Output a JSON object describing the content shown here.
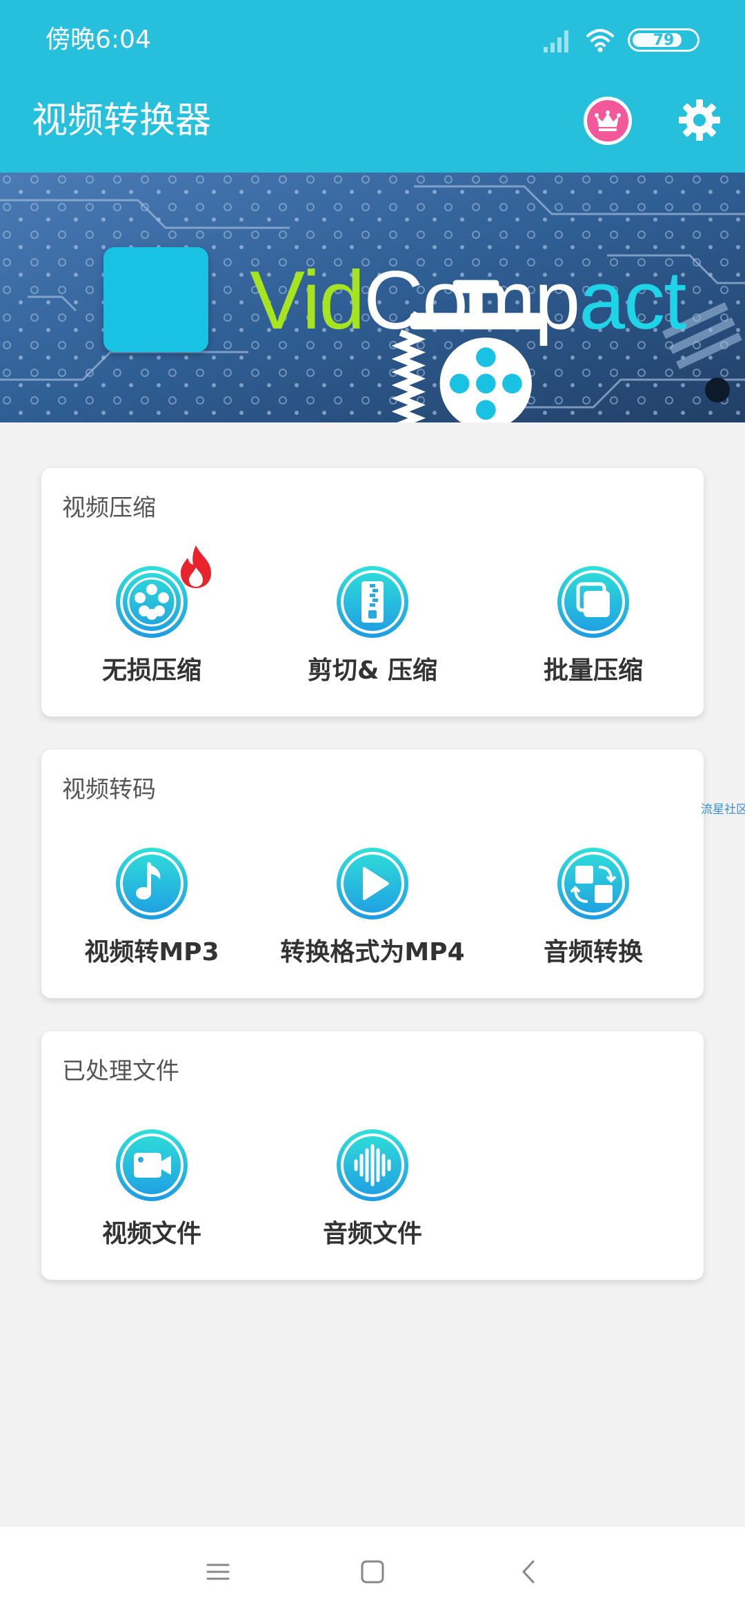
{
  "status_bar": {
    "time": "傍晚6:04",
    "battery_level": "79",
    "battery_fraction": 0.79,
    "icons": [
      "signal-icon",
      "wifi-icon",
      "battery-icon"
    ]
  },
  "app_bar": {
    "title": "视频转换器",
    "vip_icon": "crown-icon",
    "settings_icon": "gear-icon"
  },
  "banner": {
    "logo_icon": "vise-film-reel-icon",
    "wordmark": {
      "part1": "Vid",
      "part2": "Comp",
      "part3": "act"
    }
  },
  "sections": {
    "compress": {
      "title": "视频压缩",
      "items": [
        {
          "label": "无损压缩",
          "icon": "film-reel-icon",
          "badge": "fire-icon"
        },
        {
          "label": "剪切& 压缩",
          "icon": "zipper-icon"
        },
        {
          "label": "批量压缩",
          "icon": "stacked-squares-icon"
        }
      ]
    },
    "transcode": {
      "title": "视频转码",
      "items": [
        {
          "label": "视频转MP3",
          "icon": "music-note-icon"
        },
        {
          "label": "转换格式为MP4",
          "icon": "play-icon"
        },
        {
          "label": "音频转换",
          "icon": "swap-icon"
        }
      ]
    },
    "files": {
      "title": "已处理文件",
      "items": [
        {
          "label": "视频文件",
          "icon": "video-camera-icon"
        },
        {
          "label": "音频文件",
          "icon": "audio-wave-icon"
        }
      ]
    }
  },
  "side_text": "流星社区",
  "colors": {
    "header": "#27c0dc",
    "icon_gradient_top": "#2fe0d8",
    "icon_gradient_bottom": "#1f9be3",
    "vip_pink": "#f3589a",
    "fire_red": "#e8232c"
  },
  "nav_bar": {
    "icons": [
      "menu-icon",
      "home-icon",
      "back-icon"
    ]
  }
}
